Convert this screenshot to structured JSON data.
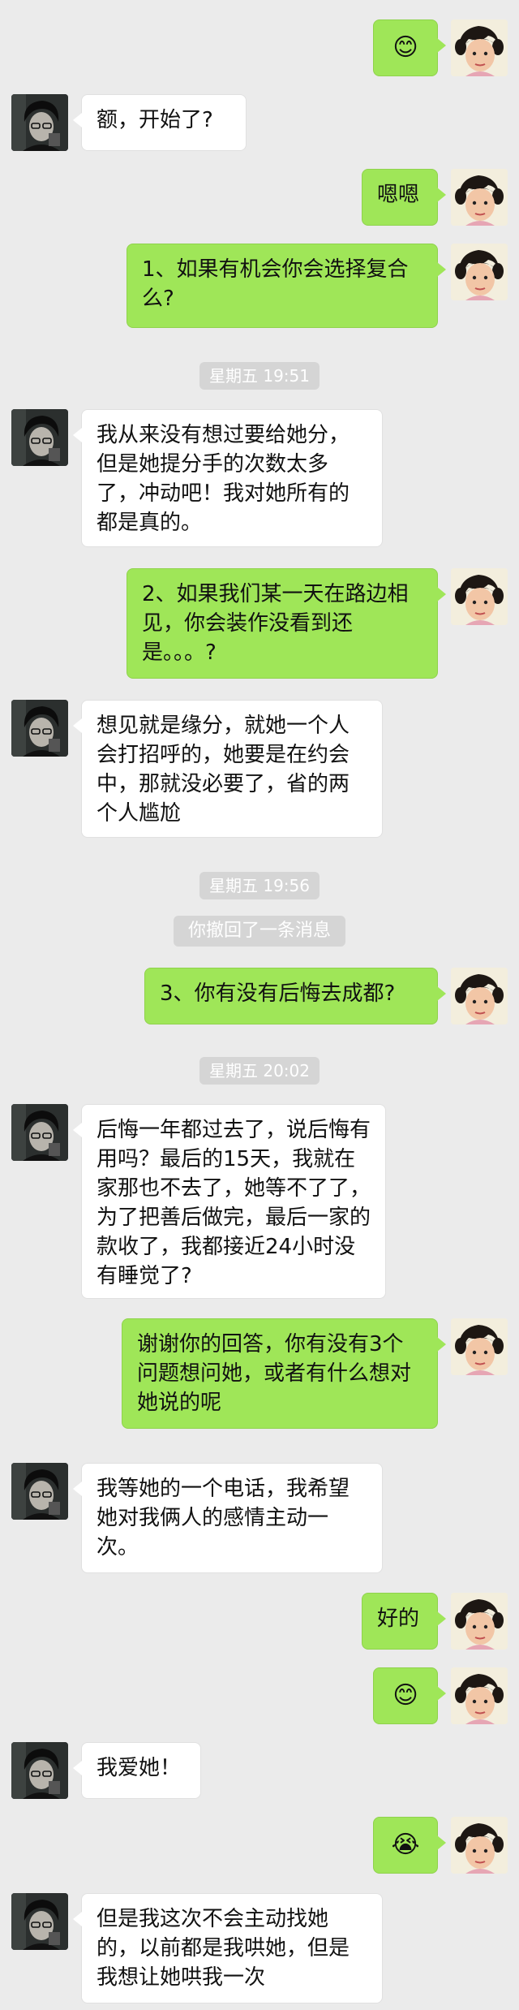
{
  "chat": {
    "messages": [
      {
        "sender": "me",
        "emoji": "😊",
        "avatar": "girl-avatar"
      },
      {
        "sender": "other",
        "text": "额，开始了?",
        "avatar": "man-avatar"
      },
      {
        "sender": "me",
        "text": "嗯嗯",
        "avatar": "girl-avatar"
      },
      {
        "sender": "me",
        "text": "1、如果有机会你会选择复合么?"
      },
      {
        "timestamp": "星期五 19:51"
      },
      {
        "sender": "other",
        "text": "我从来没有想过要给她分，但是她提分手的次数太多了，冲动吧！我对她所有的都是真的。"
      },
      {
        "sender": "me",
        "text": "2、如果我们某一天在路边相见，你会装作没看到还是。。。?"
      },
      {
        "sender": "other",
        "text": "想见就是缘分，就她一个人会打招呼的，她要是在约会中，那就没必要了，省的两个人尴尬"
      },
      {
        "timestamp": "星期五 19:56"
      },
      {
        "notice": "你撤回了一条消息"
      },
      {
        "sender": "me",
        "text": "3、你有没有后悔去成都?"
      },
      {
        "timestamp": "星期五 20:02"
      },
      {
        "sender": "other",
        "text": "后悔一年都过去了，说后悔有用吗？最后的15天，我就在家那也不去了，她等不了了，为了把善后做完，最后一家的款收了，我都接近24小时没有睡觉了?"
      },
      {
        "sender": "me",
        "text": "谢谢你的回答，你有没有3个问题想问她，或者有什么想对她说的呢"
      },
      {
        "sender": "other",
        "text": "我等她的一个电话，我希望她对我俩人的感情主动一次。"
      },
      {
        "sender": "me",
        "text": "好的"
      },
      {
        "sender": "me",
        "emoji": "😊"
      },
      {
        "sender": "other",
        "text": "我爱她！"
      },
      {
        "sender": "me",
        "emoji": "😭"
      },
      {
        "sender": "other",
        "text": "但是我这次不会主动找她的，以前都是我哄她，但是我想让她哄我一次"
      }
    ]
  }
}
